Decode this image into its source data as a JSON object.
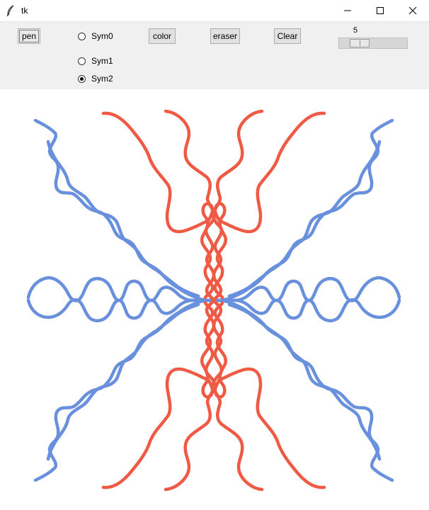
{
  "window": {
    "title": "tk"
  },
  "toolbar": {
    "pen_label": "pen",
    "color_label": "color",
    "eraser_label": "eraser",
    "clear_label": "Clear",
    "symmetry_options": [
      "Sym0",
      "Sym1",
      "Sym2"
    ],
    "selected_symmetry": "Sym2",
    "size": {
      "value": "5",
      "min": 1,
      "max": 20,
      "fraction": 0.21
    }
  },
  "canvas": {
    "stroke_colors": {
      "red": "#ef5a45",
      "blue": "#6890dc"
    },
    "background": "#ffffff"
  },
  "icons": [
    "feather-icon",
    "minimize-icon",
    "maximize-icon",
    "close-icon"
  ]
}
